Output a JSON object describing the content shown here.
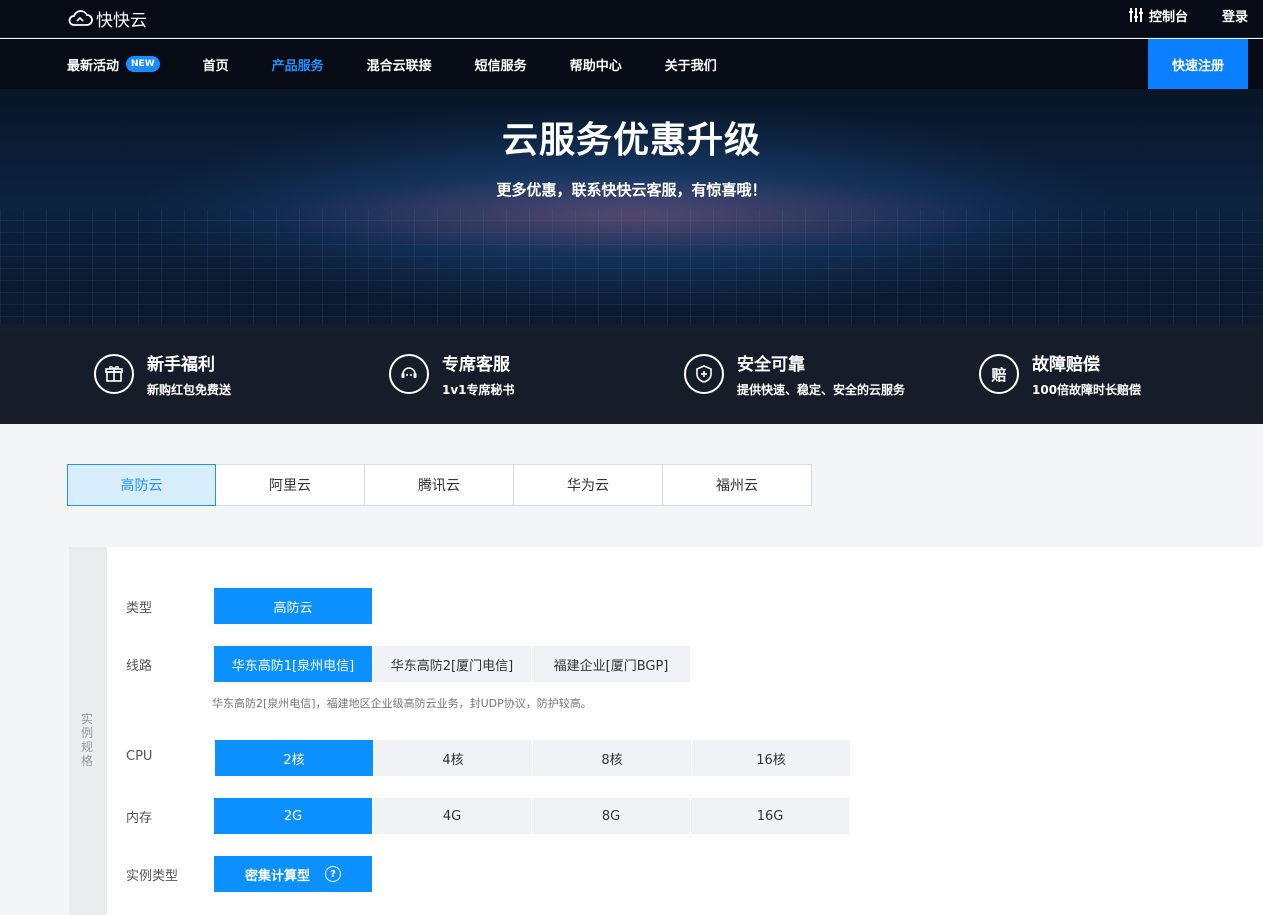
{
  "brand": {
    "logo_text": "快快云"
  },
  "top_links": {
    "console": "控制台",
    "login": "登录"
  },
  "nav": {
    "items": [
      {
        "label": "最新活动",
        "badge": "NEW"
      },
      {
        "label": "首页"
      },
      {
        "label": "产品服务",
        "active": true
      },
      {
        "label": "混合云联接"
      },
      {
        "label": "短信服务"
      },
      {
        "label": "帮助中心"
      },
      {
        "label": "关于我们"
      }
    ],
    "register_button": "快速注册"
  },
  "hero": {
    "title": "云服务优惠升级",
    "subtitle": "更多优惠，联系快快云客服，有惊喜哦！"
  },
  "features": [
    {
      "icon": "gift-icon",
      "title": "新手福利",
      "desc": "新购红包免费送"
    },
    {
      "icon": "chat-icon",
      "title": "专席客服",
      "desc": "1v1专席秘书"
    },
    {
      "icon": "shield-plus-icon",
      "title": "安全可靠",
      "desc": "提供快速、稳定、安全的云服务"
    },
    {
      "icon": "compensation-icon",
      "title": "故障赔偿",
      "desc": "100倍故障时长赔偿",
      "glyph": "赔"
    }
  ],
  "tabs": [
    {
      "label": "高防云",
      "active": true
    },
    {
      "label": "阿里云"
    },
    {
      "label": "腾讯云"
    },
    {
      "label": "华为云"
    },
    {
      "label": "福州云"
    }
  ],
  "config": {
    "side_label": "实例规格",
    "type": {
      "label": "类型",
      "options": [
        "高防云"
      ],
      "selected": 0
    },
    "line": {
      "label": "线路",
      "options": [
        "华东高防1[泉州电信]",
        "华东高防2[厦门电信]",
        "福建企业[厦门BGP]"
      ],
      "selected": 0,
      "hint": "华东高防2[泉州电信]，福建地区企业级高防云业务，封UDP协议，防护较高。"
    },
    "cpu": {
      "label": "CPU",
      "options": [
        "2核",
        "4核",
        "8核",
        "16核"
      ],
      "selected": 0
    },
    "memory": {
      "label": "内存",
      "options": [
        "2G",
        "4G",
        "8G",
        "16G"
      ],
      "selected": 0
    },
    "instance_type": {
      "label": "实例类型",
      "options": [
        "密集计算型"
      ],
      "selected": 0,
      "help": "?"
    }
  },
  "colors": {
    "accent": "#0a90ff",
    "nav_bg": "#070b16",
    "active_nav": "#1e90ff"
  }
}
